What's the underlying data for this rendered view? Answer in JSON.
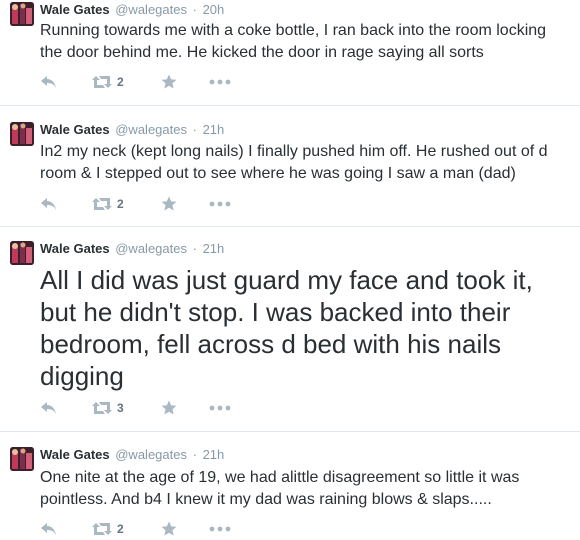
{
  "colors": {
    "icon": "#aab8c2",
    "meta": "#8899a6",
    "text": "#292f33",
    "divider": "#e1e8ed"
  },
  "tweets": [
    {
      "name": "Wale Gates",
      "handle": "@walegates",
      "separator": "·",
      "time": "20h",
      "text": "Running towards me with a coke bottle, I ran back into the room locking the door behind me. He kicked the door in rage saying all sorts",
      "retweets": "2",
      "icons": [
        "reply-icon",
        "retweet-icon",
        "favorite-icon",
        "more-icon"
      ]
    },
    {
      "name": "Wale Gates",
      "handle": "@walegates",
      "separator": "·",
      "time": "21h",
      "text": "In2 my neck (kept long nails) I finally pushed him off. He rushed out of d room & I stepped out to see where he was going I saw a man (dad)",
      "retweets": "2",
      "icons": [
        "reply-icon",
        "retweet-icon",
        "favorite-icon",
        "more-icon"
      ]
    },
    {
      "name": "Wale Gates",
      "handle": "@walegates",
      "separator": "·",
      "time": "21h",
      "text": "All I did was just guard my face and took it, but he didn't stop. I was backed into their bedroom, fell across d bed with his nails digging",
      "retweets": "3",
      "icons": [
        "reply-icon",
        "retweet-icon",
        "favorite-icon",
        "more-icon"
      ]
    },
    {
      "name": "Wale Gates",
      "handle": "@walegates",
      "separator": "·",
      "time": "21h",
      "text": "One nite at the age of 19, we had alittle disagreement so little it was pointless. And b4 I knew it my dad was raining blows & slaps.....",
      "retweets": "2",
      "icons": [
        "reply-icon",
        "retweet-icon",
        "favorite-icon",
        "more-icon"
      ]
    }
  ]
}
